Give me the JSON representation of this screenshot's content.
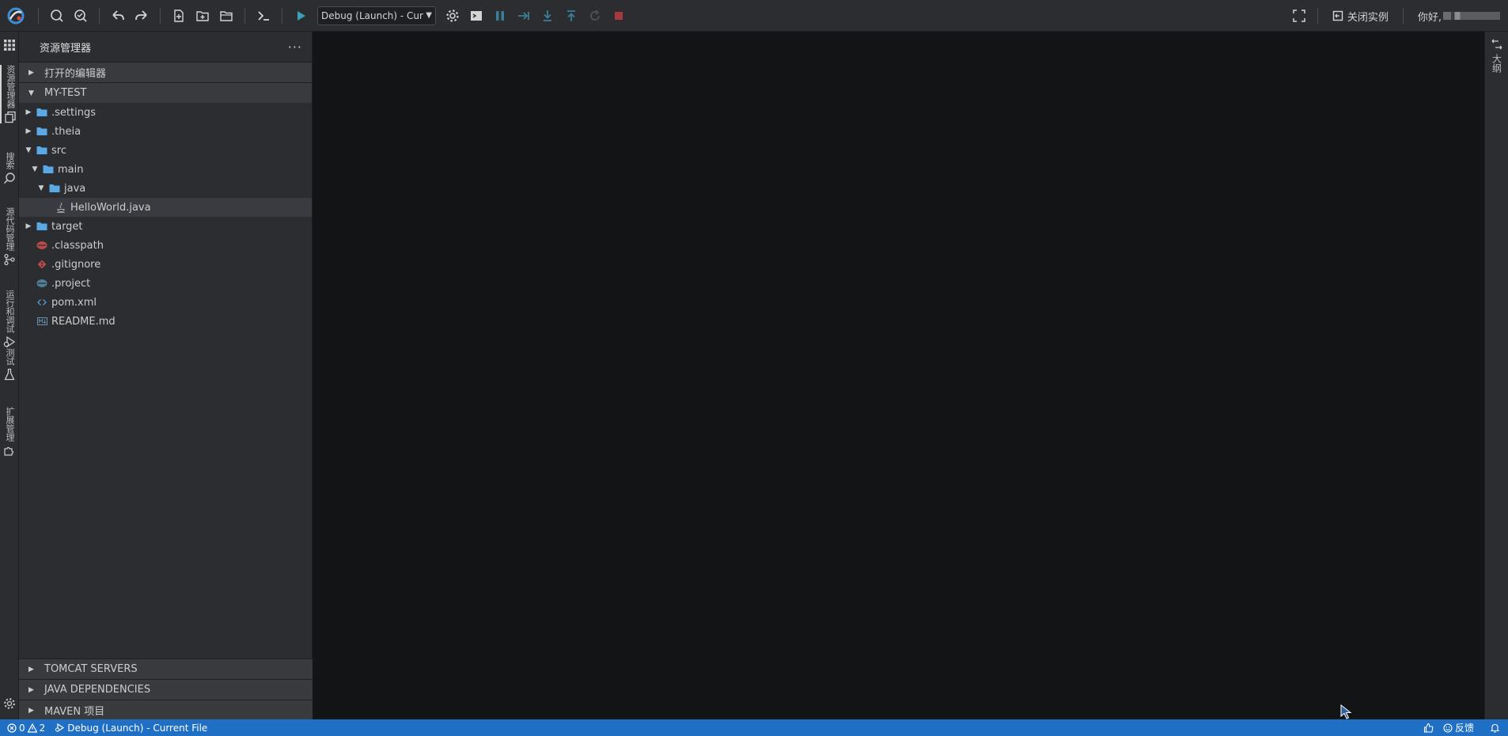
{
  "toolbar": {
    "debug_config": "Debug (Launch) - Current File",
    "close_instance": "关闭实例",
    "greeting": "你好,"
  },
  "activity_bar": {
    "items": [
      {
        "label": "资源管理器",
        "icon": "files-icon"
      },
      {
        "label": "搜索",
        "icon": "search-icon"
      },
      {
        "label": "源代码管理",
        "icon": "source-control-icon"
      },
      {
        "label": "运行和调试",
        "icon": "run-debug-icon"
      },
      {
        "label": "测试",
        "icon": "beaker-icon"
      },
      {
        "label": "扩展管理",
        "icon": "extensions-icon"
      }
    ]
  },
  "explorer": {
    "title": "资源管理器",
    "open_editors": "打开的编辑器",
    "workspace": "MY-TEST",
    "tree": [
      {
        "name": ".settings",
        "type": "folder",
        "depth": 0,
        "expanded": false
      },
      {
        "name": ".theia",
        "type": "folder",
        "depth": 0,
        "expanded": false
      },
      {
        "name": "src",
        "type": "folder",
        "depth": 0,
        "expanded": true
      },
      {
        "name": "main",
        "type": "folder",
        "depth": 1,
        "expanded": true
      },
      {
        "name": "java",
        "type": "folder",
        "depth": 2,
        "expanded": true
      },
      {
        "name": "HelloWorld.java",
        "type": "java",
        "depth": 3,
        "selected": true
      },
      {
        "name": "target",
        "type": "folder",
        "depth": 0,
        "expanded": false
      },
      {
        "name": ".classpath",
        "type": "classpath",
        "depth": 0
      },
      {
        "name": ".gitignore",
        "type": "git",
        "depth": 0
      },
      {
        "name": ".project",
        "type": "project",
        "depth": 0
      },
      {
        "name": "pom.xml",
        "type": "xml",
        "depth": 0
      },
      {
        "name": "README.md",
        "type": "md",
        "depth": 0
      }
    ],
    "bottom_sections": [
      "TOMCAT SERVERS",
      "JAVA DEPENDENCIES",
      "MAVEN 项目"
    ]
  },
  "right_bar": {
    "outline": "大纲"
  },
  "statusbar": {
    "errors": "0",
    "warnings": "2",
    "debug": "Debug (Launch) - Current File",
    "feedback": "反馈"
  },
  "colors": {
    "accent": "#1f6fc5",
    "folder": "#5aa9e6",
    "run": "#3a9fb8"
  }
}
